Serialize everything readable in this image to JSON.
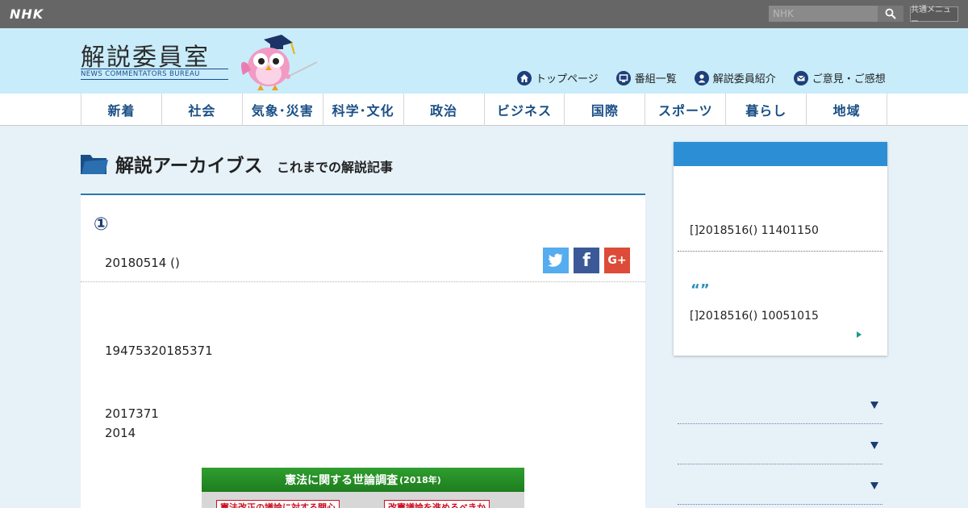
{
  "topbar": {
    "logo": "NHK",
    "search_placeholder": "NHK",
    "common_menu": "共通メニュー"
  },
  "header": {
    "brand_title": "解説委員室",
    "brand_subtitle": "NEWS COMMENTATORS BUREAU",
    "nav": [
      {
        "label": "トップページ",
        "icon": "home-icon"
      },
      {
        "label": "番組一覧",
        "icon": "tv-icon"
      },
      {
        "label": "解説委員紹介",
        "icon": "person-icon"
      },
      {
        "label": "ご意見・ご感想",
        "icon": "mail-icon"
      }
    ]
  },
  "categories": [
    "新着",
    "社会",
    "気象･災害",
    "科学･文化",
    "政治",
    "ビジネス",
    "国際",
    "スポーツ",
    "暮らし",
    "地域"
  ],
  "section": {
    "title": "解説アーカイブス",
    "subtitle": "これまでの解説記事"
  },
  "article": {
    "title": "①",
    "date": "20180514 ()",
    "paragraphs": [
      "19475320185371",
      "2017371",
      "2014"
    ],
    "share": {
      "twitter": "t",
      "facebook": "f",
      "google": "G+"
    },
    "survey": {
      "title": "憲法に関する世論調査",
      "year": "(2018年)",
      "chip1": "憲法改正の議論に対する関心",
      "chip2": "改憲議論を進めるべきか"
    }
  },
  "sidebar": {
    "item1": "[]2018516() 11401150",
    "quote": "“”",
    "item2": "[]2018516() 10051015"
  },
  "colors": {
    "topbar": "#666666",
    "header_bg": "#c8ecfa",
    "category_text": "#1a4f86",
    "accent_blue": "#2c8fd6",
    "page_bg": "#e6f1f8"
  }
}
